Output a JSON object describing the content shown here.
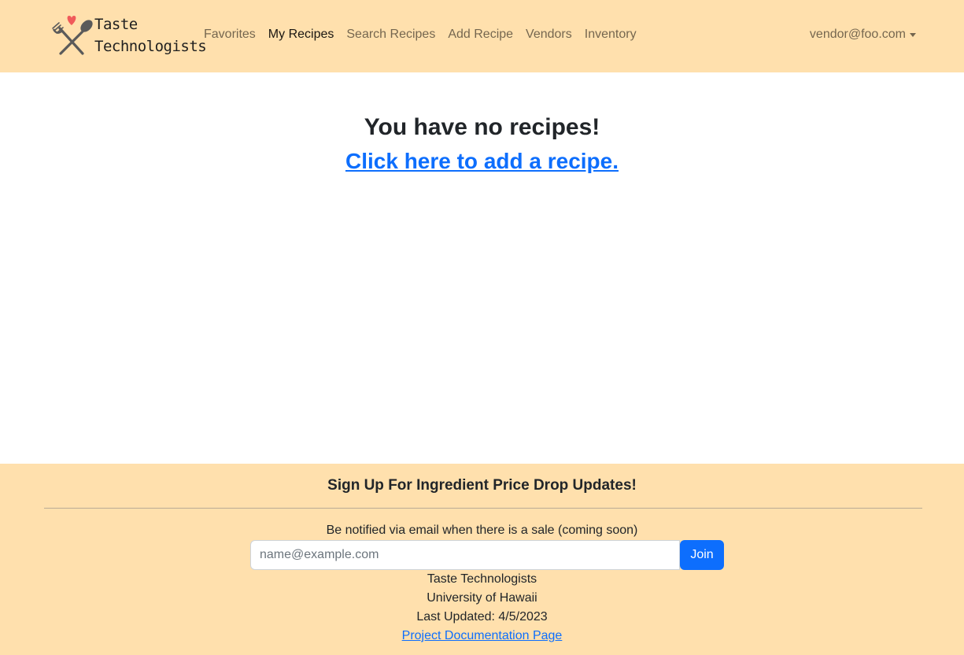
{
  "navbar": {
    "brand": {
      "line1": "Taste",
      "line2": "Technologists",
      "logo_icon": "fork-spoon-heart-icon",
      "heart_color": "#f05a5a"
    },
    "links": [
      {
        "label": "Favorites",
        "active": false
      },
      {
        "label": "My Recipes",
        "active": true
      },
      {
        "label": "Search Recipes",
        "active": false
      },
      {
        "label": "Add Recipe",
        "active": false
      },
      {
        "label": "Vendors",
        "active": false
      },
      {
        "label": "Inventory",
        "active": false
      }
    ],
    "user": {
      "email": "vendor@foo.com",
      "icon": "chevron-down-icon"
    }
  },
  "main": {
    "empty_title": "You have no recipes!",
    "add_link": "Click here to add a recipe."
  },
  "footer": {
    "signup_title": "Sign Up For Ingredient Price Drop Updates!",
    "signup_desc": "Be notified via email when there is a sale (coming soon)",
    "email_placeholder": "name@example.com",
    "join_label": "Join",
    "org": "Taste Technologists",
    "university": "University of Hawaii",
    "last_updated": "Last Updated: 4/5/2023",
    "doc_link": "Project Documentation Page"
  },
  "colors": {
    "nav_bg": "#ffe0ad",
    "accent": "#0d6efd"
  }
}
